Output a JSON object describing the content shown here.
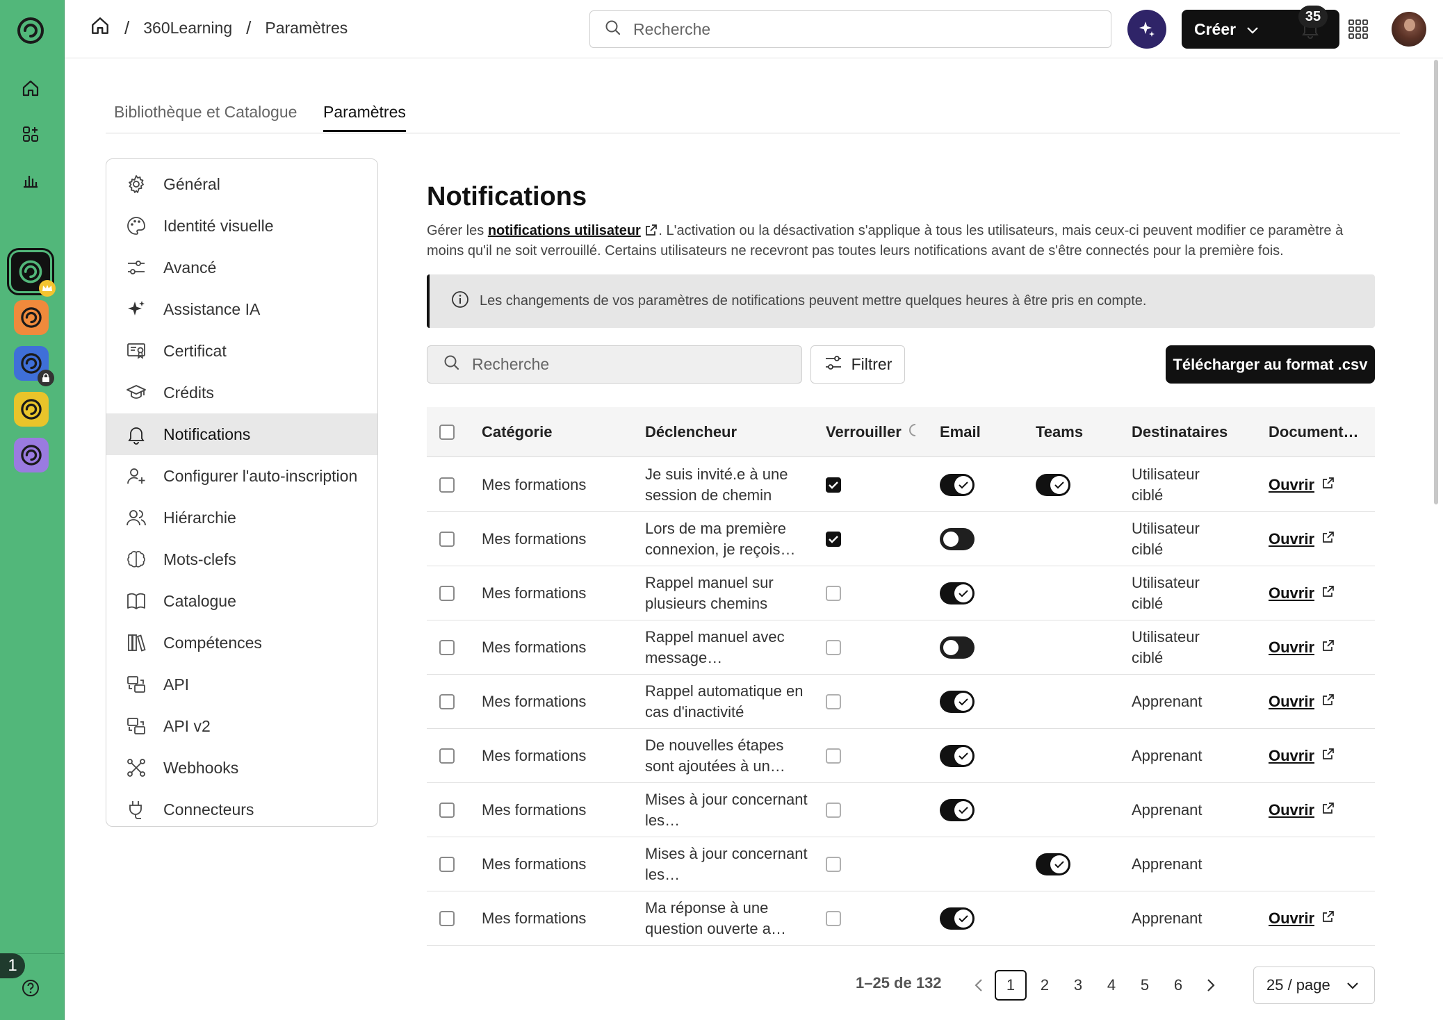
{
  "breadcrumb": {
    "root": "360Learning",
    "current": "Paramètres"
  },
  "search": {
    "placeholder": "Recherche"
  },
  "header": {
    "create_label": "Créer",
    "notification_count": "35"
  },
  "rail": {
    "badge_number": "1"
  },
  "tabs": [
    {
      "label": "Bibliothèque et Catalogue"
    },
    {
      "label": "Paramètres"
    }
  ],
  "settings_menu": [
    {
      "label": "Général",
      "icon": "gear-icon"
    },
    {
      "label": "Identité visuelle",
      "icon": "palette-icon"
    },
    {
      "label": "Avancé",
      "icon": "sliders-icon"
    },
    {
      "label": "Assistance IA",
      "icon": "sparkle-icon"
    },
    {
      "label": "Certificat",
      "icon": "certificate-icon"
    },
    {
      "label": "Crédits",
      "icon": "graduation-cap-icon"
    },
    {
      "label": "Notifications",
      "icon": "bell-icon",
      "active": true
    },
    {
      "label": "Configurer l'auto-inscription",
      "icon": "user-plus-icon"
    },
    {
      "label": "Hiérarchie",
      "icon": "users-icon"
    },
    {
      "label": "Mots-clefs",
      "icon": "brain-icon"
    },
    {
      "label": "Catalogue",
      "icon": "book-icon"
    },
    {
      "label": "Compétences",
      "icon": "books-icon"
    },
    {
      "label": "API",
      "icon": "api-icon"
    },
    {
      "label": "API v2",
      "icon": "api-icon"
    },
    {
      "label": "Webhooks",
      "icon": "webhook-icon"
    },
    {
      "label": "Connecteurs",
      "icon": "plug-icon"
    }
  ],
  "main": {
    "title": "Notifications",
    "desc_prefix": "Gérer les ",
    "desc_link": "notifications utilisateur",
    "desc_suffix": ". L'activation ou la désactivation s'applique à tous les utilisateurs, mais ceux-ci peuvent modifier ce paramètre à moins qu'il ne soit verrouillé. Certains utilisateurs ne recevront pas toutes leurs notifications avant de s'être connectés pour la première fois.",
    "info": "Les changements de vos paramètres de notifications peuvent mettre quelques heures à être pris en compte.",
    "search_placeholder": "Recherche",
    "filter_label": "Filtrer",
    "csv_label": "Télécharger au format .csv"
  },
  "table": {
    "columns": [
      "Catégorie",
      "Déclencheur",
      "Verrouiller",
      "Email",
      "Teams",
      "Destinataires",
      "Document…"
    ],
    "rows": [
      {
        "category": "Mes formations",
        "trigger": "Je suis invité.e à une session de chemin",
        "locked": true,
        "email": "on",
        "teams": "on",
        "recipients": "Utilisateur ciblé",
        "doc": "Ouvrir"
      },
      {
        "category": "Mes formations",
        "trigger": "Lors de ma première connexion, je reçois…",
        "locked": true,
        "email": "off",
        "teams": "",
        "recipients": "Utilisateur ciblé",
        "doc": "Ouvrir"
      },
      {
        "category": "Mes formations",
        "trigger": "Rappel manuel sur plusieurs chemins",
        "locked": false,
        "email": "on",
        "teams": "",
        "recipients": "Utilisateur ciblé",
        "doc": "Ouvrir"
      },
      {
        "category": "Mes formations",
        "trigger": "Rappel manuel avec message…",
        "locked": false,
        "email": "off",
        "teams": "",
        "recipients": "Utilisateur ciblé",
        "doc": "Ouvrir"
      },
      {
        "category": "Mes formations",
        "trigger": "Rappel automatique en cas d'inactivité",
        "locked": false,
        "email": "on",
        "teams": "",
        "recipients": "Apprenant",
        "doc": "Ouvrir"
      },
      {
        "category": "Mes formations",
        "trigger": "De nouvelles étapes sont ajoutées à un…",
        "locked": false,
        "email": "on",
        "teams": "",
        "recipients": "Apprenant",
        "doc": "Ouvrir"
      },
      {
        "category": "Mes formations",
        "trigger": "Mises à jour concernant les…",
        "locked": false,
        "email": "on",
        "teams": "",
        "recipients": "Apprenant",
        "doc": "Ouvrir"
      },
      {
        "category": "Mes formations",
        "trigger": "Mises à jour concernant les…",
        "locked": false,
        "email": "",
        "teams": "on",
        "recipients": "Apprenant",
        "doc": ""
      },
      {
        "category": "Mes formations",
        "trigger": "Ma réponse à une question ouverte a…",
        "locked": false,
        "email": "on",
        "teams": "",
        "recipients": "Apprenant",
        "doc": "Ouvrir"
      }
    ]
  },
  "pagination": {
    "range": "1–25 de 132",
    "pages": [
      "1",
      "2",
      "3",
      "4",
      "5",
      "6"
    ],
    "current": "1",
    "page_size": "25 / page"
  },
  "colors": {
    "rail": "#52b77a",
    "primary": "#111111",
    "ai": "#2f2468"
  }
}
